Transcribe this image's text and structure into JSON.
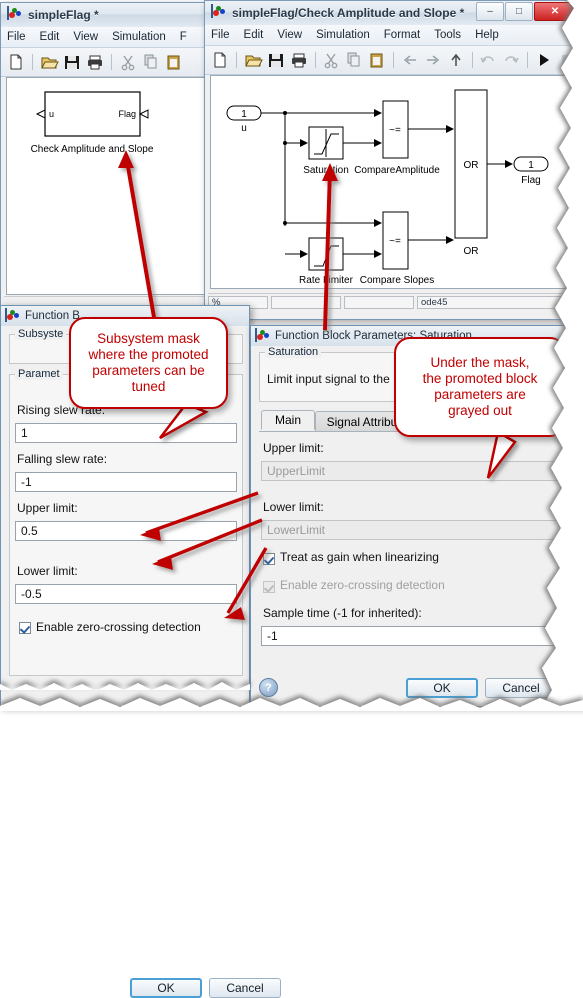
{
  "window_main": {
    "title": "simpleFlag *",
    "icon": "simulink-icon",
    "menus": [
      "File",
      "Edit",
      "View",
      "Simulation",
      "F"
    ],
    "toolbar_icons": [
      "new-file-icon",
      "open-folder-icon",
      "save-icon",
      "print-icon",
      "cut-icon",
      "copy-icon",
      "paste-icon"
    ],
    "diagram": {
      "block_label": "Check Amplitude and Slope",
      "input_port_label": "u",
      "output_port_label": "Flag"
    }
  },
  "window_sub": {
    "title": "simpleFlag/Check Amplitude and Slope *",
    "icon": "simulink-icon",
    "controls": {
      "minimize": "–",
      "maximize": "□",
      "close": "✕"
    },
    "menus": [
      "File",
      "Edit",
      "View",
      "Simulation",
      "Format",
      "Tools",
      "Help"
    ],
    "toolbar_icons": [
      "new-file-icon",
      "open-folder-icon",
      "save-icon",
      "print-icon",
      "cut-icon",
      "copy-icon",
      "paste-icon",
      "back-arrow-icon",
      "forward-arrow-icon",
      "up-arrow-icon",
      "undo-icon",
      "redo-icon",
      "run-icon",
      "stop-icon"
    ],
    "diagram": {
      "inport_number": "1",
      "inport_label": "u",
      "saturation_label": "Saturation",
      "compare_amplitude_label": "CompareAmplitude",
      "compare_amplitude_op": "~=",
      "rate_limiter_label": "Rate Limiter",
      "compare_slopes_label": "Compare Slopes",
      "compare_slopes_op": "~=",
      "or_block_text": "OR",
      "or_block_label": "OR",
      "outport_number": "1",
      "outport_label": "Flag"
    },
    "statusbar": {
      "zoom": "%",
      "cell2": "",
      "cell3": "",
      "solver": "ode45"
    }
  },
  "dialog_mask": {
    "title": "Function B",
    "icon": "simulink-icon",
    "group_subsystem_label": "Subsyste",
    "group_parameters_label": "Paramet",
    "fields": [
      {
        "label": "Rising slew rate:",
        "value": "1"
      },
      {
        "label": "Falling slew rate:",
        "value": "-1"
      },
      {
        "label": "Upper limit:",
        "value": "0.5"
      },
      {
        "label": "Lower limit:",
        "value": "-0.5"
      }
    ],
    "checkbox": {
      "label": "Enable zero-crossing detection",
      "checked": true
    },
    "buttons": {
      "ok": "OK",
      "cancel": "Cancel"
    }
  },
  "dialog_block": {
    "title": "Function Block Parameters: Saturation",
    "icon": "simulink-icon",
    "group_label": "Saturation",
    "description": "Limit input signal to the",
    "tabs": [
      {
        "label": "Main",
        "active": true
      },
      {
        "label": "Signal Attributes",
        "active": false
      }
    ],
    "fields": [
      {
        "label": "Upper limit:",
        "value": "UpperLimit",
        "disabled": true
      },
      {
        "label": "Lower limit:",
        "value": "LowerLimit",
        "disabled": true
      }
    ],
    "checkboxes": [
      {
        "label": "Treat as gain when linearizing",
        "checked": true,
        "disabled": false
      },
      {
        "label": "Enable zero-crossing detection",
        "checked": true,
        "disabled": true
      }
    ],
    "sample_time": {
      "label": "Sample time (-1 for inherited):",
      "value": "-1"
    },
    "help_icon": "help-question-icon",
    "buttons": {
      "ok": "OK",
      "cancel": "Cancel"
    }
  },
  "annotations": {
    "callout_left": "Subsystem mask\nwhere the promoted\nparameters can be\ntuned",
    "callout_right": "Under the mask,\nthe promoted block\nparameters are\ngrayed out",
    "accent_color": "#c00000"
  }
}
